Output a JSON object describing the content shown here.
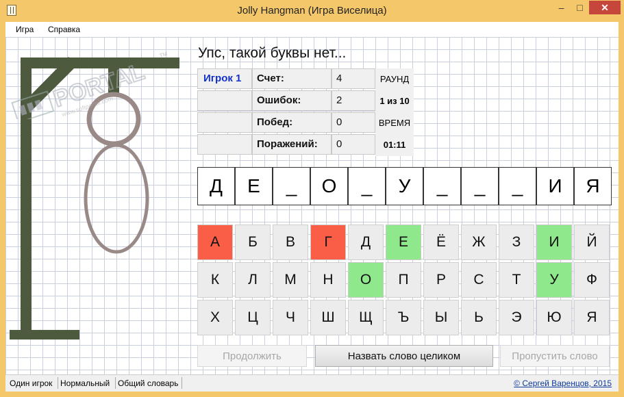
{
  "window": {
    "title": "Jolly Hangman (Игра Виселица)",
    "min_glyph": "‒",
    "max_glyph": "□",
    "close_glyph": "✕"
  },
  "menu": [
    "Игра",
    "Справка"
  ],
  "message": "Упс, такой буквы нет...",
  "stats": {
    "player": "Игрок 1",
    "labels": [
      "Счет:",
      "Ошибок:",
      "Побед:",
      "Поражений:"
    ],
    "values": [
      "4",
      "2",
      "0",
      "0"
    ],
    "round_label": "РАУНД",
    "round_value": "1 из 10",
    "time_label": "ВРЕМЯ",
    "time_value": "01:11"
  },
  "word": [
    "Д",
    "Е",
    "_",
    "О",
    "_",
    "У",
    "_",
    "_",
    "_",
    "И",
    "Я"
  ],
  "keyboard": {
    "rows": [
      [
        "А",
        "Б",
        "В",
        "Г",
        "Д",
        "Е",
        "Ё",
        "Ж",
        "З",
        "И",
        "Й"
      ],
      [
        "К",
        "Л",
        "М",
        "Н",
        "О",
        "П",
        "Р",
        "С",
        "Т",
        "У",
        "Ф"
      ],
      [
        "Х",
        "Ц",
        "Ч",
        "Ш",
        "Щ",
        "Ъ",
        "Ы",
        "Ь",
        "Э",
        "Ю",
        "Я"
      ]
    ],
    "wrong_letters": [
      "А",
      "Г"
    ],
    "correct_letters": [
      "Е",
      "И",
      "О",
      "У"
    ],
    "wrong_color": "#fb5e47",
    "correct_color": "#8fe98c"
  },
  "buttons": {
    "continue": "Продолжить",
    "guess_word": "Назвать слово целиком",
    "skip_word": "Пропустить слово"
  },
  "status": {
    "mode": "Один игрок",
    "difficulty": "Нормальный",
    "dictionary": "Общий словарь",
    "copyright": "© Сергей Варенцов, 2015"
  },
  "watermark": {
    "brand": "PORTAL",
    "tm": "TM",
    "url": "www.softportal.com"
  },
  "colors": {
    "gallows": "#4d5a3e",
    "figure": "#9a8a87",
    "title_bar": "#f4c86a",
    "close_button": "#c7463b"
  }
}
